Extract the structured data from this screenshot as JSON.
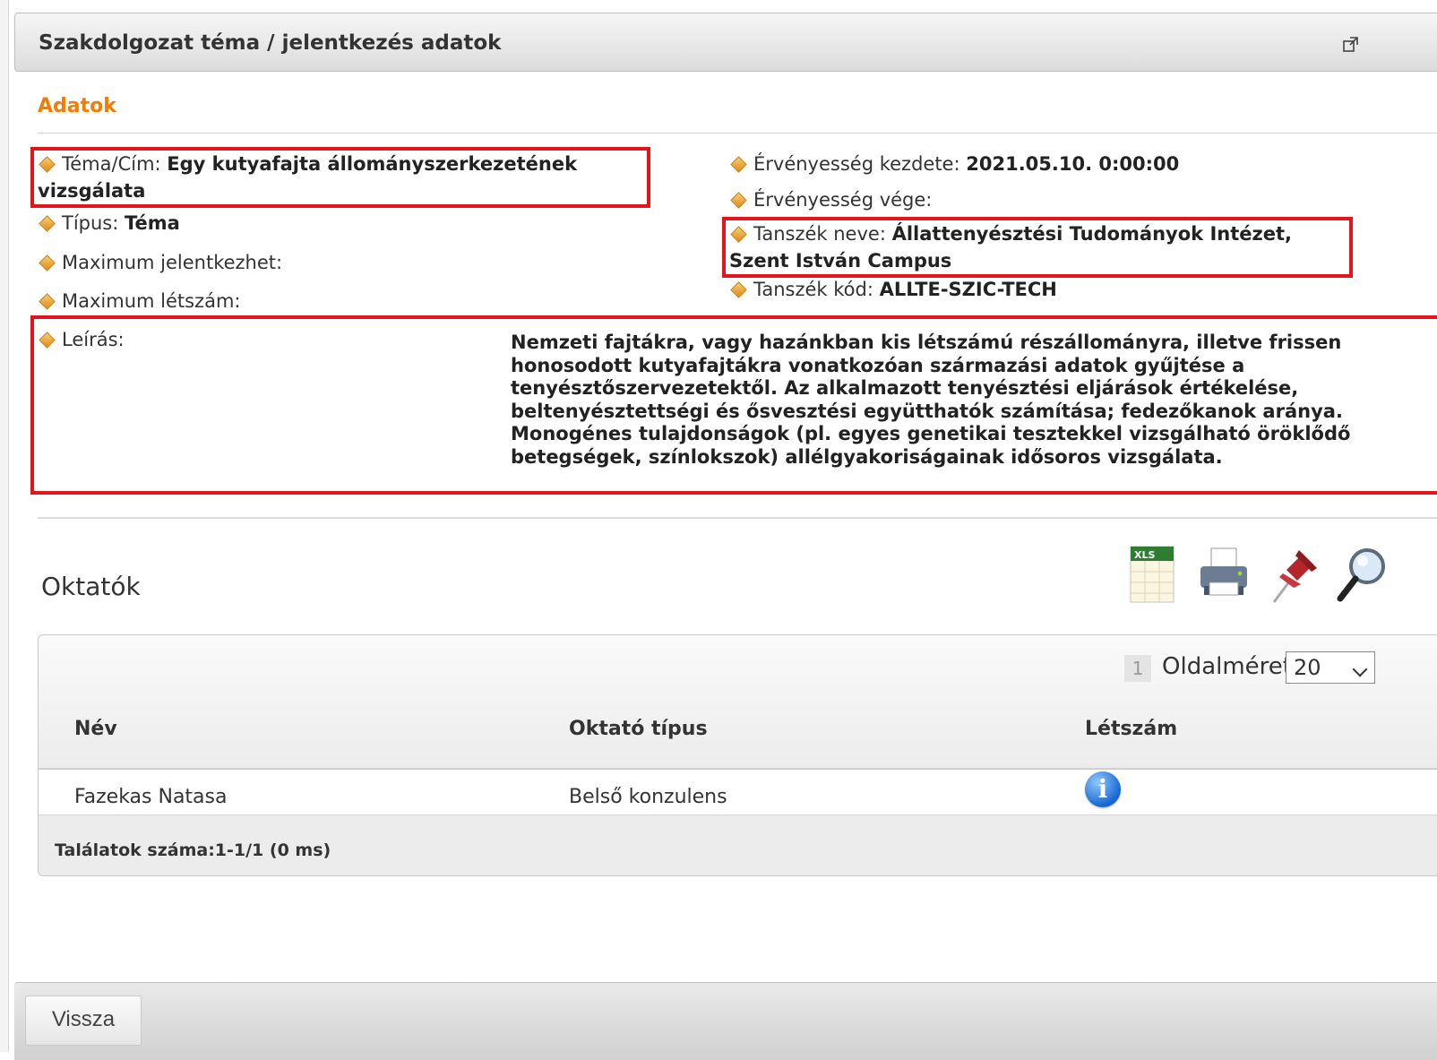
{
  "window": {
    "title": "Szakdolgozat téma / jelentkezés adatok",
    "popout_icon": "external-link-icon"
  },
  "section": {
    "title": "Adatok"
  },
  "fields": {
    "tema_label": "Téma/Cím:",
    "tema_value": "Egy kutyafajta állományszerkezetének vizsgálata",
    "tipus_label": "Típus:",
    "tipus_value": "Téma",
    "max_jelentkezhet_label": "Maximum jelentkezhet:",
    "max_letszam_label": "Maximum létszám:",
    "ervenyesseg_kezdete_label": "Érvényesség kezdete:",
    "ervenyesseg_kezdete_value": "2021.05.10. 0:00:00",
    "ervenyesseg_vege_label": "Érvényesség vége:",
    "tanszek_neve_label": "Tanszék neve:",
    "tanszek_neve_value": "Állattenyésztési Tudományok Intézet, Szent István Campus",
    "tanszek_kod_label": "Tanszék kód:",
    "tanszek_kod_value": "ALLTE-SZIC-TECH",
    "leiras_label": "Leírás:",
    "leiras_value": "Nemzeti fajtákra, vagy hazánkban kis létszámú részállományra, illetve frissen honosodott kutyafajtákra vonatkozóan származási adatok gyűjtése a tenyésztőszervezetektől. Az alkalmazott tenyésztési eljárások értékelése, beltenyésztettségi és ősvesztési együtthatók számítása; fedezőkanok aránya. Monogénes tulajdonságok (pl. egyes genetikai tesztekkel vizsgálható öröklődő betegségek, színlokszok) allélgyakoriságainak idősoros vizsgálata."
  },
  "oktatok": {
    "title": "Oktatók",
    "toolbar_icons": [
      "xls-export-icon",
      "print-icon",
      "pin-icon",
      "search-icon"
    ],
    "pager": {
      "page": "1",
      "page_size_label": "Oldalméret",
      "page_size_value": "20"
    },
    "columns": [
      "Név",
      "Oktató típus",
      "Létszám"
    ],
    "rows": [
      {
        "nev": "Fazekas Natasa",
        "tipus": "Belső konzulens",
        "letszam_icon": "info-icon"
      }
    ],
    "footer": "Találatok száma:1-1/1 (0 ms)"
  },
  "buttons": {
    "back": "Vissza"
  },
  "colors": {
    "accent": "#f57c00",
    "highlight": "#e3141b",
    "info": "#1767d1"
  }
}
